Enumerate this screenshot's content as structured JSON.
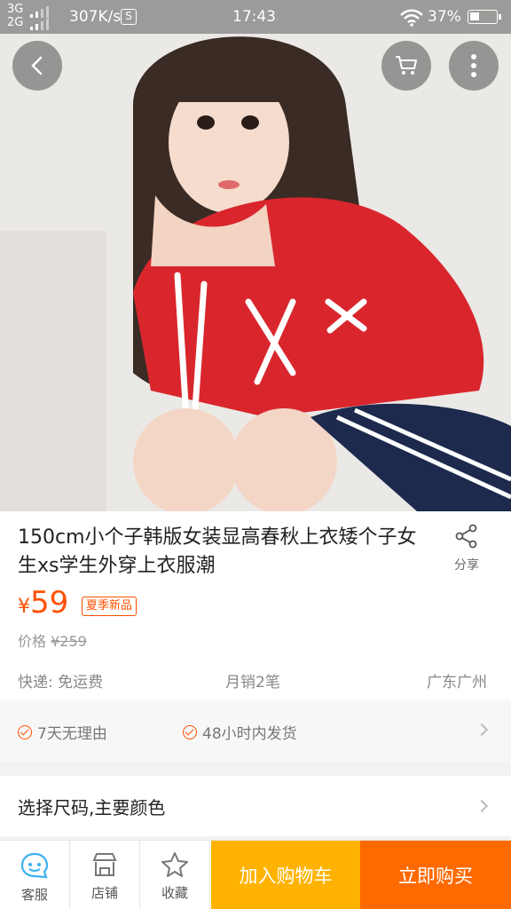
{
  "status_bar": {
    "network_top": "3G",
    "network_bottom": "2G",
    "speed": "307K/s",
    "sim_icon_label": "S",
    "time": "17:43",
    "battery": "37%",
    "battery_level": 0.37
  },
  "nav": {
    "back_icon": "back-chevron-icon",
    "cart_icon": "cart-icon",
    "more_icon": "more-vertical-icon"
  },
  "product": {
    "title": "150cm小个子韩版女装显高春秋上衣矮个子女生xs学生外穿上衣服潮",
    "share_label": "分享",
    "price_symbol": "¥",
    "price": "59",
    "tag": "夏季新品",
    "original_price_label": "价格",
    "original_price": "¥259",
    "shipping": "快递: 免运费",
    "monthly_sales": "月销2笔",
    "location": "广东广州"
  },
  "guarantees": [
    "7天无理由",
    "48小时内发货"
  ],
  "sku": {
    "label": "选择尺码,主要颜色"
  },
  "bottom_bar": {
    "service_label": "客服",
    "shop_label": "店铺",
    "favorite_label": "收藏",
    "add_to_cart_label": "加入购物车",
    "buy_now_label": "立即购买"
  },
  "colors": {
    "accent": "#ff5000",
    "cart_button": "#ffb300",
    "buy_button": "#ff6a00"
  }
}
